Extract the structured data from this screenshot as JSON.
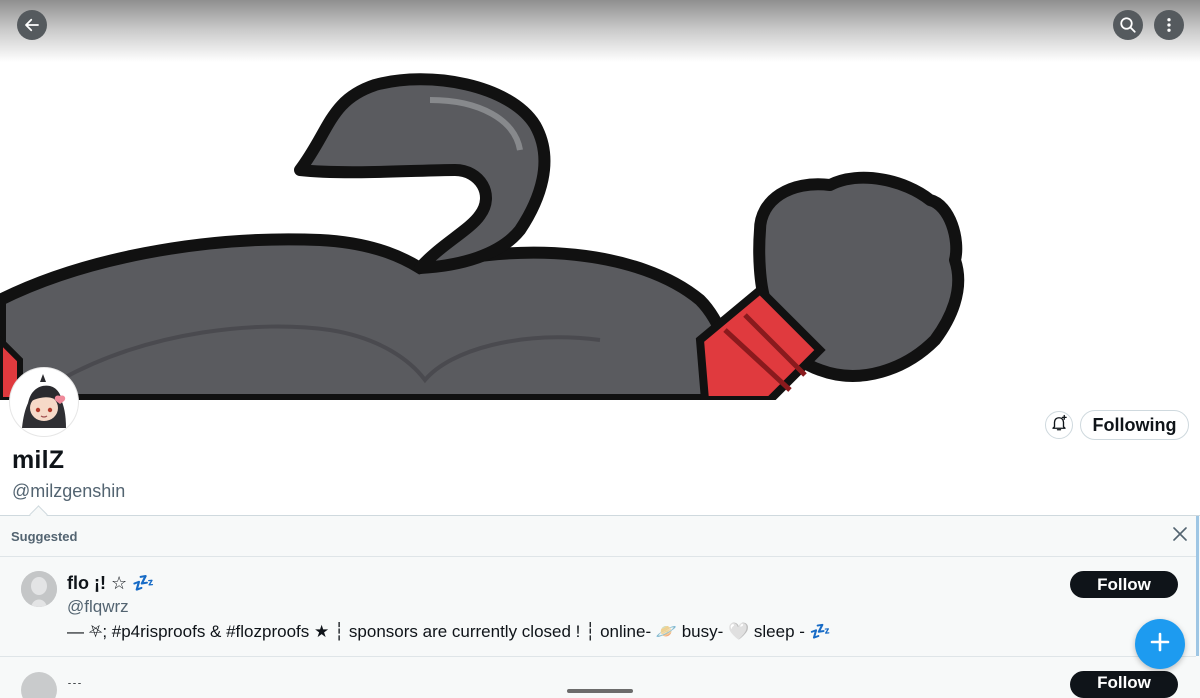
{
  "topbar": {
    "back_icon": "arrow-left-icon",
    "search_icon": "search-icon",
    "more_icon": "more-vertical-icon"
  },
  "profile": {
    "display_name": "milZ",
    "handle": "@milzgenshin",
    "notify_icon": "bell-plus-icon",
    "following_label": "Following"
  },
  "suggested": {
    "title": "Suggested",
    "close_icon": "close-icon",
    "users": [
      {
        "name": "flo ¡! ☆ 💤",
        "handle": "@flqwrz",
        "bio": "— ⛧; #p4risproofs & #flozproofs ★ ┆ sponsors are currently closed ! ┆ online- 🪐 busy- 🤍 sleep - 💤",
        "follow_label": "Follow"
      },
      {
        "name": "...",
        "follow_label": "Follow"
      }
    ]
  },
  "fab": {
    "icon": "plus-icon"
  },
  "colors": {
    "accent": "#1d9bf0",
    "text_primary": "#0f1419",
    "text_secondary": "#536471",
    "follow_button": "#0f1419"
  }
}
